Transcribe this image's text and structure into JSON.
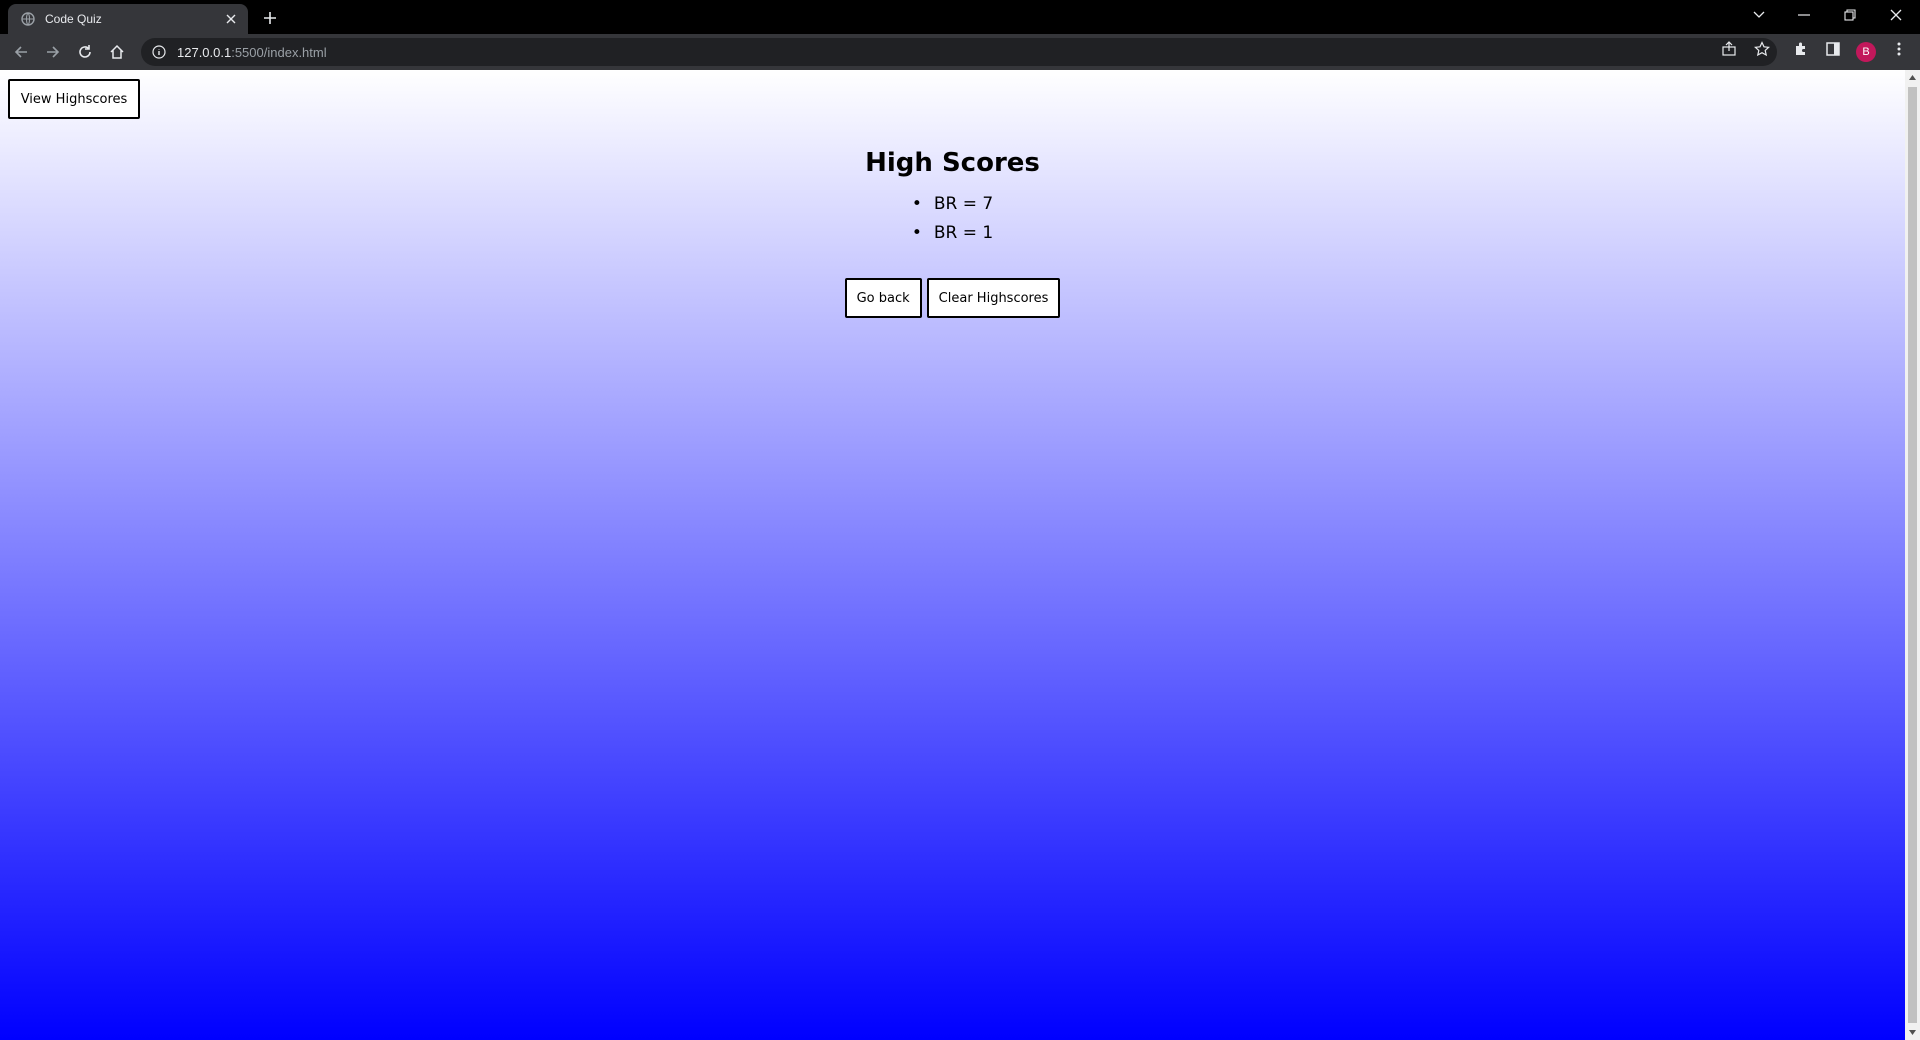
{
  "browser": {
    "tab_title": "Code Quiz",
    "url_host": "127.0.0.1",
    "url_path": ":5500/index.html",
    "profile_initial": "B"
  },
  "page": {
    "view_highscores_label": "View Highscores",
    "title": "High Scores",
    "scores": [
      "BR = 7",
      "BR = 1"
    ],
    "go_back_label": "Go back",
    "clear_label": "Clear Highscores"
  },
  "colors": {
    "gradient_top": "#ffffff",
    "gradient_bottom": "#0000ff",
    "avatar": "#c2185b"
  }
}
